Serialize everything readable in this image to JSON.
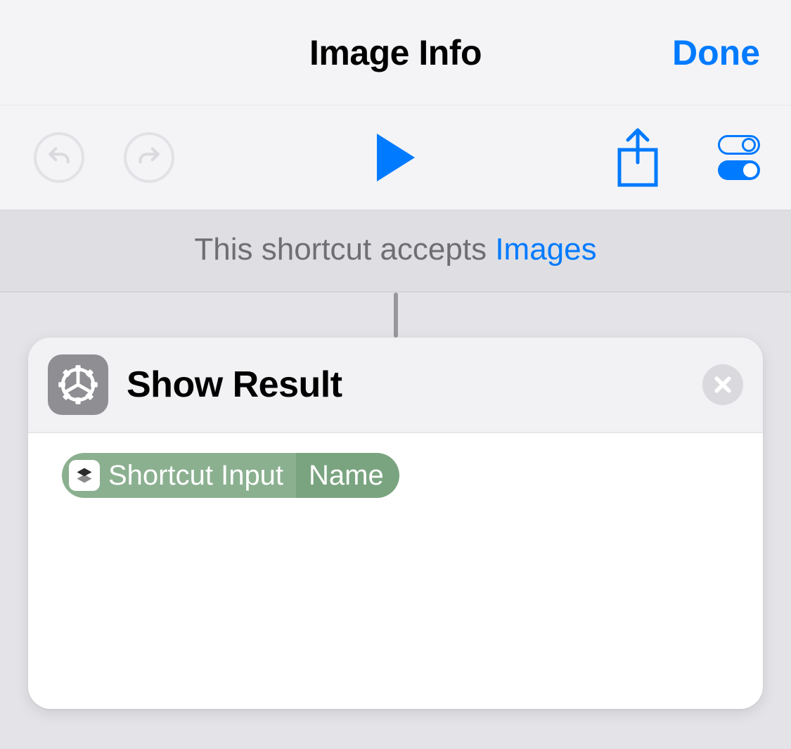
{
  "navbar": {
    "title": "Image Info",
    "done": "Done"
  },
  "accepts": {
    "prefix": "This shortcut accepts ",
    "type": "Images"
  },
  "action": {
    "title": "Show Result",
    "variable": {
      "label": "Shortcut Input",
      "detail": "Name"
    }
  }
}
